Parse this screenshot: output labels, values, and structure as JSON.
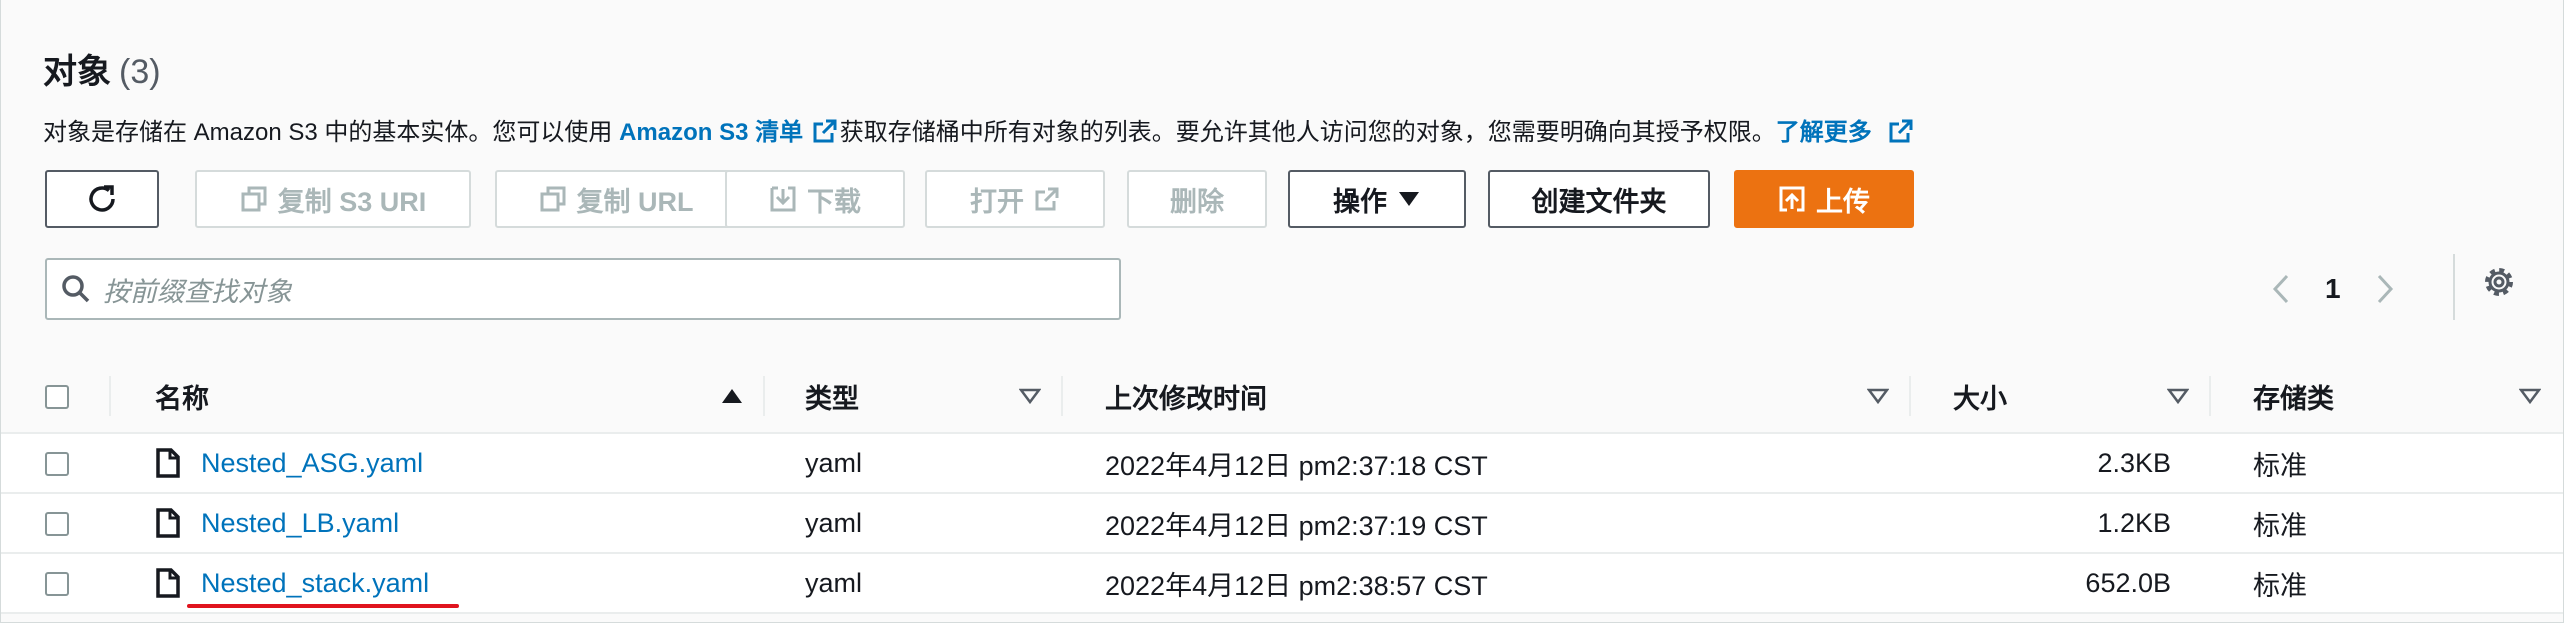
{
  "header": {
    "title": "对象",
    "count": "(3)",
    "description_prefix": "对象是存储在 Amazon S3 中的基本实体。您可以使用 ",
    "inventory_link": "Amazon S3 清单",
    "description_middle": "获取存储桶中所有对象的列表。要允许其他人访问您的对象，您需要明确向其授予权限。",
    "learn_more": "了解更多"
  },
  "toolbar": {
    "copy_s3_uri": "复制 S3 URI",
    "copy_url": "复制 URL",
    "download": "下载",
    "open": "打开",
    "delete": "删除",
    "actions": "操作",
    "create_folder": "创建文件夹",
    "upload": "上传"
  },
  "search": {
    "placeholder": "按前缀查找对象"
  },
  "pagination": {
    "current_page": "1"
  },
  "table": {
    "columns": {
      "name": "名称",
      "type": "类型",
      "modified": "上次修改时间",
      "size": "大小",
      "storage": "存储类"
    },
    "rows": [
      {
        "name": "Nested_ASG.yaml",
        "type": "yaml",
        "modified": "2022年4月12日 pm2:37:18 CST",
        "size": "2.3KB",
        "storage": "标准"
      },
      {
        "name": "Nested_LB.yaml",
        "type": "yaml",
        "modified": "2022年4月12日 pm2:37:19 CST",
        "size": "1.2KB",
        "storage": "标准"
      },
      {
        "name": "Nested_stack.yaml",
        "type": "yaml",
        "modified": "2022年4月12日 pm2:38:57 CST",
        "size": "652.0B",
        "storage": "标准"
      }
    ]
  },
  "colors": {
    "link": "#0073bb",
    "primary": "#ec7211",
    "annotation": "#e0141e"
  }
}
